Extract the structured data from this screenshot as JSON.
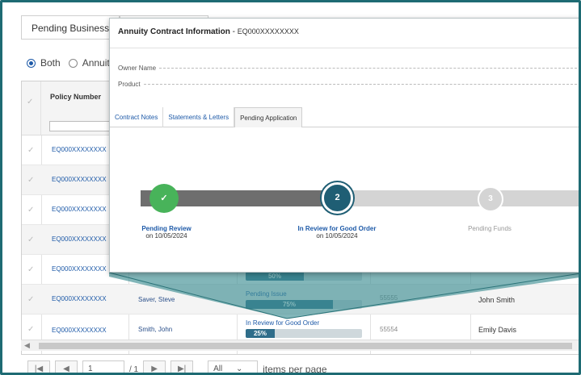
{
  "tabs": [
    {
      "label": "Pending Business"
    },
    {
      "label": ""
    }
  ],
  "filter": {
    "options": [
      {
        "label": "Both",
        "selected": true
      },
      {
        "label": "Annuit",
        "selected": false
      }
    ]
  },
  "grid": {
    "header": {
      "policy_number": "Policy Number"
    },
    "rows": [
      {
        "policy": "EQ000XXXXXXXX"
      },
      {
        "policy": "EQ000XXXXXXXX"
      },
      {
        "policy": "EQ000XXXXXXXX"
      },
      {
        "policy": "EQ000XXXXXXXX"
      },
      {
        "policy": "EQ000XXXXXXXX",
        "bar_label": "50%",
        "bar_value": 50
      },
      {
        "policy": "EQ000XXXXXXXX",
        "name": "Saver, Steve",
        "status": "Pending Issue",
        "bar_label": "75%",
        "bar_value": 75,
        "number": "55555",
        "agent": "John Smith"
      },
      {
        "policy": "EQ000XXXXXXXX",
        "name": "Smith, John",
        "status": "In Review for Good Order",
        "bar_label": "25%",
        "bar_value": 25,
        "number": "55554",
        "agent": "Emily Davis"
      }
    ]
  },
  "pager": {
    "first": "|◀",
    "prev": "◀",
    "page": "1",
    "of": "/ 1",
    "next": "▶",
    "last": "▶|",
    "page_size": "All",
    "items_label": "items per page"
  },
  "modal": {
    "title": "Annuity Contract Information",
    "separator": " - ",
    "contract": "EQ000XXXXXXXX",
    "fields": {
      "owner": "Owner Name",
      "product": "Product"
    },
    "tabs": [
      {
        "label": "Contract Notes",
        "active": false
      },
      {
        "label": "Statements & Letters",
        "active": false
      },
      {
        "label": "Pending Application",
        "active": true
      }
    ],
    "steps": [
      {
        "number": "✓",
        "name": "Pending Review",
        "date": "on 10/05/2024",
        "state": "done"
      },
      {
        "number": "2",
        "name": "In Review for Good Order",
        "date": "on 10/05/2024",
        "state": "current"
      },
      {
        "number": "3",
        "name": "Pending Funds",
        "date": "",
        "state": "todo"
      }
    ]
  },
  "colors": {
    "frame": "#1e6b73",
    "funnel": "#3f8f94",
    "link": "#1e5aa8",
    "done": "#48b35a",
    "current": "#1f5e74",
    "bar_fill": "#2f6d8a"
  }
}
